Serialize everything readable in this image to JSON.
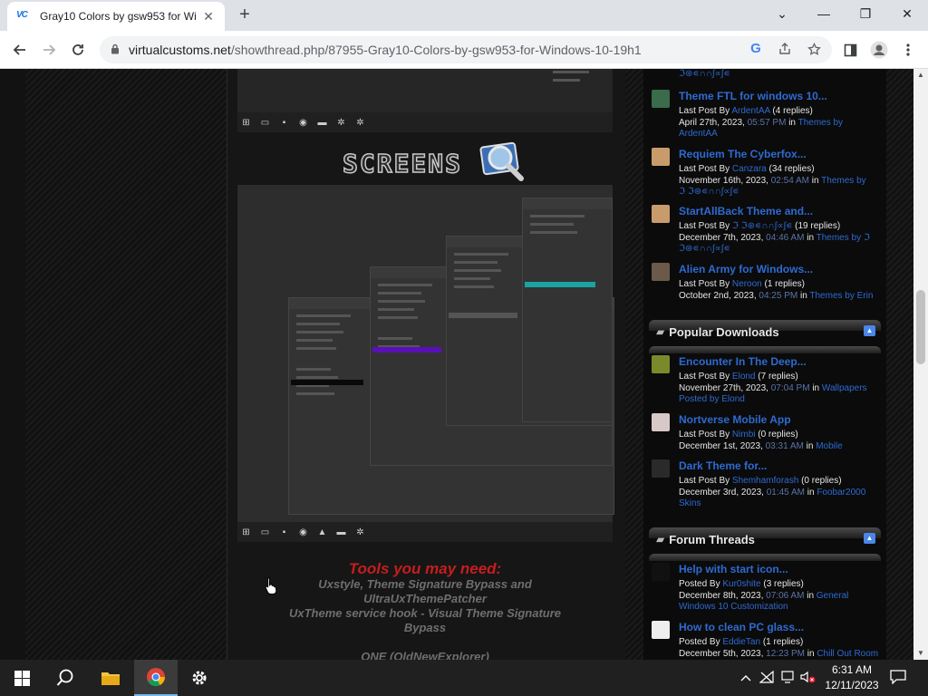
{
  "browser": {
    "tab": {
      "favicon": "VC",
      "title": "Gray10 Colors by gsw953 for Wi",
      "close": "✕"
    },
    "new_tab": "+",
    "window_controls": {
      "minimize": "—",
      "maximize": "❐",
      "close": "✕",
      "tab_search": "⌄"
    },
    "url": {
      "host": "virtualcustoms.net",
      "path": "/showthread.php/87955-Gray10-Colors-by-gsw953-for-Windows-10-19h1"
    }
  },
  "post": {
    "screens_logo_text": "SCREENS",
    "tools_title": "Tools you may need:",
    "tools_lines": [
      "Uxstyle, Theme Signature Bypass and",
      "UltraUxThemePatcher",
      "UxTheme service hook - Visual Theme Signature",
      "Bypass",
      "",
      "ONE (OldNewExplorer)"
    ]
  },
  "sidebar": {
    "top_fragment": "ℑ⊛∊∩∩∫∝∫∊",
    "latest_threads": [
      {
        "title": "Theme FTL for windows 10...",
        "lines": [
          [
            {
              "t": "Last Post By "
            },
            {
              "t": "ArdentAA",
              "c": "lnk"
            },
            {
              "t": " (4 replies)"
            }
          ],
          [
            {
              "t": "April 27th, 2023, "
            },
            {
              "t": "05:57 PM",
              "c": "dim"
            },
            {
              "t": " in "
            },
            {
              "t": "Themes by",
              "c": "lnk"
            }
          ],
          [
            {
              "t": "ArdentAA",
              "c": "lnk"
            }
          ]
        ],
        "avatar": "#3a6b4a"
      },
      {
        "title": "Requiem The Cyberfox...",
        "lines": [
          [
            {
              "t": "Last Post By "
            },
            {
              "t": "Canzara",
              "c": "lnk"
            },
            {
              "t": " (34 replies)"
            }
          ],
          [
            {
              "t": "November 16th, 2023, "
            },
            {
              "t": "02:54 AM",
              "c": "dim"
            },
            {
              "t": " in "
            },
            {
              "t": "Themes by",
              "c": "lnk"
            }
          ],
          [
            {
              "t": "ℑ ℑ⊛∊∩∩∫∝∫∊",
              "c": "lnk"
            }
          ]
        ],
        "avatar": "#c89c6a"
      },
      {
        "title": "StartAllBack Theme and...",
        "lines": [
          [
            {
              "t": "Last Post By "
            },
            {
              "t": "ℑ ℑ⊛∊∩∩∫∝∫∊",
              "c": "lnk"
            },
            {
              "t": " (19 replies)"
            }
          ],
          [
            {
              "t": "December 7th, 2023, "
            },
            {
              "t": "04:46 AM",
              "c": "dim"
            },
            {
              "t": " in "
            },
            {
              "t": "Themes by ℑ",
              "c": "lnk"
            }
          ],
          [
            {
              "t": "ℑ⊛∊∩∩∫∝∫∊",
              "c": "lnk"
            }
          ]
        ],
        "avatar": "#c89c6a"
      },
      {
        "title": "Alien Army for Windows...",
        "lines": [
          [
            {
              "t": "Last Post By "
            },
            {
              "t": "Neroon",
              "c": "lnk"
            },
            {
              "t": " (1 replies)"
            }
          ],
          [
            {
              "t": "October 2nd, 2023, "
            },
            {
              "t": "04:25 PM",
              "c": "dim"
            },
            {
              "t": " in "
            },
            {
              "t": "Themes by Erin",
              "c": "lnk"
            }
          ]
        ],
        "avatar": "#6b5a4a"
      }
    ],
    "popular_header": "Popular Downloads",
    "popular": [
      {
        "title": "Encounter In The Deep...",
        "lines": [
          [
            {
              "t": "Last Post By "
            },
            {
              "t": "Elond",
              "c": "lnk"
            },
            {
              "t": " (7 replies)"
            }
          ],
          [
            {
              "t": "November 27th, 2023, "
            },
            {
              "t": "07:04 PM",
              "c": "dim"
            },
            {
              "t": " in "
            },
            {
              "t": "Wallpapers",
              "c": "lnk"
            }
          ],
          [
            {
              "t": "Posted by Elond",
              "c": "lnk"
            }
          ]
        ],
        "avatar": "#7a8a2a"
      },
      {
        "title": "Nortverse Mobile App",
        "lines": [
          [
            {
              "t": "Last Post By "
            },
            {
              "t": "Nimbi",
              "c": "lnk"
            },
            {
              "t": " (0 replies)"
            }
          ],
          [
            {
              "t": "December 1st, 2023, "
            },
            {
              "t": "03:31 AM",
              "c": "dim"
            },
            {
              "t": " in "
            },
            {
              "t": "Mobile",
              "c": "lnk"
            }
          ]
        ],
        "avatar": "#d8c8c8"
      },
      {
        "title": "Dark Theme for...",
        "lines": [
          [
            {
              "t": "Last Post By "
            },
            {
              "t": "Shemhamforash",
              "c": "lnk"
            },
            {
              "t": " (0 replies)"
            }
          ],
          [
            {
              "t": "December 3rd, 2023, "
            },
            {
              "t": "01:45 AM",
              "c": "dim"
            },
            {
              "t": " in "
            },
            {
              "t": "Foobar2000",
              "c": "lnk"
            }
          ],
          [
            {
              "t": "Skins",
              "c": "lnk"
            }
          ]
        ],
        "avatar": "#2a2a2a"
      }
    ],
    "forum_header": "Forum Threads",
    "forum": [
      {
        "title": "Help with start icon...",
        "lines": [
          [
            {
              "t": "Posted By "
            },
            {
              "t": "Kur0shite",
              "c": "lnk"
            },
            {
              "t": " (3 replies)"
            }
          ],
          [
            {
              "t": "December 8th, 2023, "
            },
            {
              "t": "07:06 AM",
              "c": "dim"
            },
            {
              "t": " in "
            },
            {
              "t": "General",
              "c": "lnk"
            }
          ],
          [
            {
              "t": "Windows 10 Customization",
              "c": "lnk"
            }
          ]
        ],
        "avatar": "#111111"
      },
      {
        "title": "How to clean PC glass...",
        "lines": [
          [
            {
              "t": "Posted By "
            },
            {
              "t": "EddieTan",
              "c": "lnk"
            },
            {
              "t": " (1 replies)"
            }
          ],
          [
            {
              "t": "December 5th, 2023, "
            },
            {
              "t": "12:23 PM",
              "c": "dim"
            },
            {
              "t": " in "
            },
            {
              "t": "Chill Out Room",
              "c": "lnk"
            }
          ]
        ],
        "avatar": "#eeeeee"
      }
    ]
  },
  "taskbar": {
    "time": "6:31 AM",
    "date": "12/11/2023"
  },
  "colors": {
    "link": "#2e6ad1",
    "accent_red": "#c61d1d",
    "collapse_btn": "#4a86e8"
  }
}
